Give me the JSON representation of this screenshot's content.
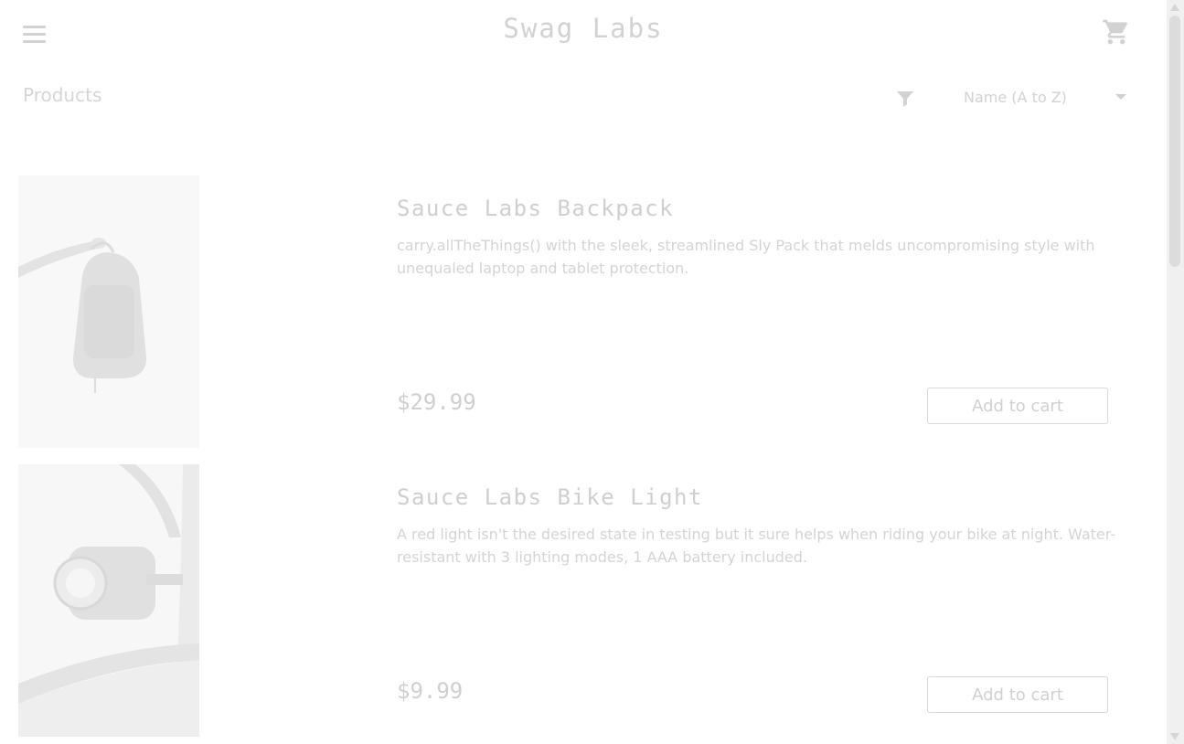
{
  "header": {
    "app_title": "Swag Labs",
    "menu_icon": "hamburger-menu-icon",
    "cart_icon": "shopping-cart-icon"
  },
  "subheader": {
    "title": "Products",
    "filter_icon": "filter-icon",
    "sort": {
      "selected": "Name (A to Z)"
    }
  },
  "inventory": {
    "items": [
      {
        "name": "Sauce Labs Backpack",
        "description": "carry.allTheThings() with the sleek, streamlined Sly Pack that melds uncompromising style with unequaled laptop and tablet protection.",
        "price": "$29.99",
        "button_label": "Add to cart",
        "image_icon": "backpack-photo"
      },
      {
        "name": "Sauce Labs Bike Light",
        "description": "A red light isn't the desired state in testing but it sure helps when riding your bike at night. Water-resistant with 3 lighting modes, 1 AAA battery included.",
        "price": "$9.99",
        "button_label": "Add to cart",
        "image_icon": "bike-light-photo"
      }
    ]
  },
  "colors": {
    "background": "#ffffff",
    "faded_text": "#d2d2d2",
    "scrollbar_track": "#f0f0f0"
  }
}
